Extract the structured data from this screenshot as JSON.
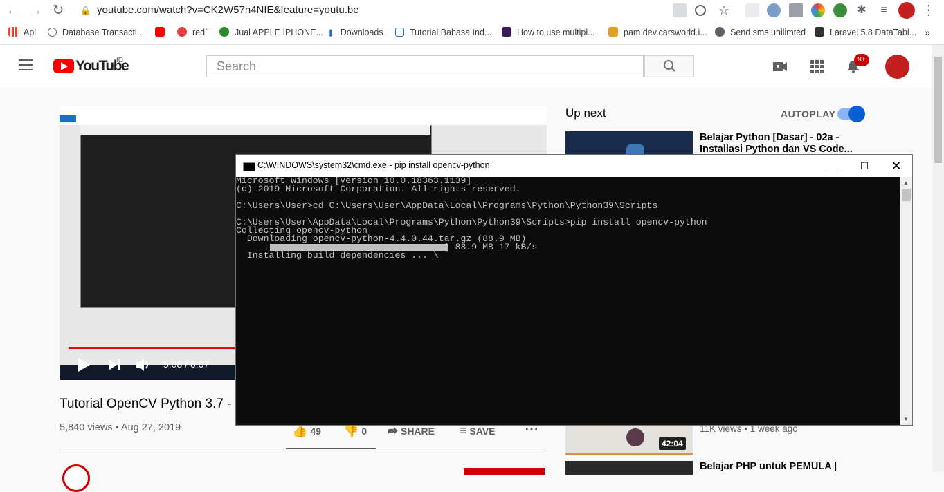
{
  "browser": {
    "url": "youtube.com/watch?v=CK2W57n4NIE&feature=youtu.be",
    "bookmarks": [
      {
        "label": "Apl"
      },
      {
        "label": "Database Transacti..."
      },
      {
        "label": ""
      },
      {
        "label": "red`"
      },
      {
        "label": "Jual APPLE IPHONE..."
      },
      {
        "label": "Downloads"
      },
      {
        "label": "Tutorial Bahasa Ind..."
      },
      {
        "label": "How to use multipl..."
      },
      {
        "label": "pam.dev.carsworld.i..."
      },
      {
        "label": "Send sms unilimted"
      },
      {
        "label": "Laravel 5.8 DataTabl..."
      }
    ],
    "more": "»"
  },
  "youtube": {
    "logo_text": "YouTube",
    "country": "ID",
    "search_placeholder": "Search",
    "notification_count": "9+",
    "video": {
      "time": "5:08 / 6:07",
      "progress_fraction": 0.837,
      "title": "Tutorial OpenCV Python 3.7 -",
      "meta": "5,840 views • Aug 27, 2019",
      "likes": "49",
      "dislikes": "0",
      "share": "SHARE",
      "save": "SAVE"
    },
    "up_next": "Up next",
    "autoplay": "AUTOPLAY",
    "recommended": [
      {
        "title": "Belajar Python [Dasar] - 02a - Installasi Python dan VS Code..."
      },
      {
        "meta": "11K views • 1 week ago",
        "duration": "42:04"
      },
      {
        "title": "Belajar PHP untuk PEMULA |"
      }
    ]
  },
  "cmd": {
    "title": "C:\\WINDOWS\\system32\\cmd.exe - pip  install opencv-python",
    "lines": [
      "Microsoft Windows [Version 10.0.18363.1139]",
      "(c) 2019 Microsoft Corporation. All rights reserved.",
      "",
      "C:\\Users\\User>cd C:\\Users\\User\\AppData\\Local\\Programs\\Python\\Python39\\Scripts",
      "",
      "C:\\Users\\User\\AppData\\Local\\Programs\\Python\\Python39\\Scripts>pip install opencv-python",
      "Collecting opencv-python",
      "  Downloading opencv-python-4.4.0.44.tar.gz (88.9 MB)",
      "     |                                | 88.9 MB 17 kB/s",
      "  Installing build dependencies ... \\"
    ]
  }
}
